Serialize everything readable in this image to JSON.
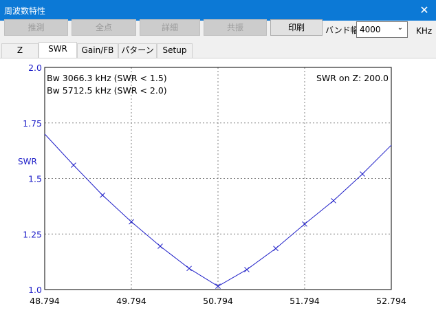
{
  "window": {
    "title": "周波数特性",
    "close_glyph": "✕"
  },
  "toolbar": {
    "buttons": [
      {
        "label": "推測",
        "enabled": false
      },
      {
        "label": "全点",
        "enabled": false
      },
      {
        "label": "詳細",
        "enabled": false
      },
      {
        "label": "共振",
        "enabled": false
      },
      {
        "label": "印刷",
        "enabled": true
      }
    ],
    "bandwidth_label": "バンド幅",
    "bandwidth_value": "4000",
    "unit": "KHz"
  },
  "tabs": [
    {
      "label": "Z",
      "active": false
    },
    {
      "label": "SWR",
      "active": true
    },
    {
      "label": "Gain/FB",
      "active": false
    },
    {
      "label": "パターン",
      "active": false
    },
    {
      "label": "Setup",
      "active": false
    }
  ],
  "chart_data": {
    "type": "line",
    "ylabel": "SWR",
    "xlim": [
      48.794,
      52.794
    ],
    "ylim": [
      1.0,
      2.0
    ],
    "x_ticks": [
      "48.794",
      "49.794",
      "50.794",
      "51.794",
      "52.794"
    ],
    "y_ticks": [
      "1.0",
      "1.25",
      "1.5",
      "1.75",
      "2.0"
    ],
    "grid": true,
    "annotations": [
      "Bw 3066.3 kHz (SWR < 1.5)",
      "Bw 5712.5 kHz (SWR < 2.0)",
      "SWR on Z: 200.0"
    ],
    "series": [
      {
        "x": [
          48.794,
          49.127,
          49.461,
          49.794,
          50.127,
          50.461,
          50.794,
          51.127,
          51.461,
          51.794,
          52.127,
          52.461,
          52.794
        ],
        "y": [
          1.7,
          1.56,
          1.425,
          1.305,
          1.195,
          1.095,
          1.015,
          1.09,
          1.185,
          1.295,
          1.4,
          1.52,
          1.65
        ],
        "markers": [
          false,
          true,
          true,
          true,
          true,
          true,
          true,
          true,
          true,
          true,
          true,
          true,
          false
        ]
      }
    ],
    "colors": {
      "line": "#1f1fc8",
      "axis_label": "#1f1fc8"
    }
  }
}
